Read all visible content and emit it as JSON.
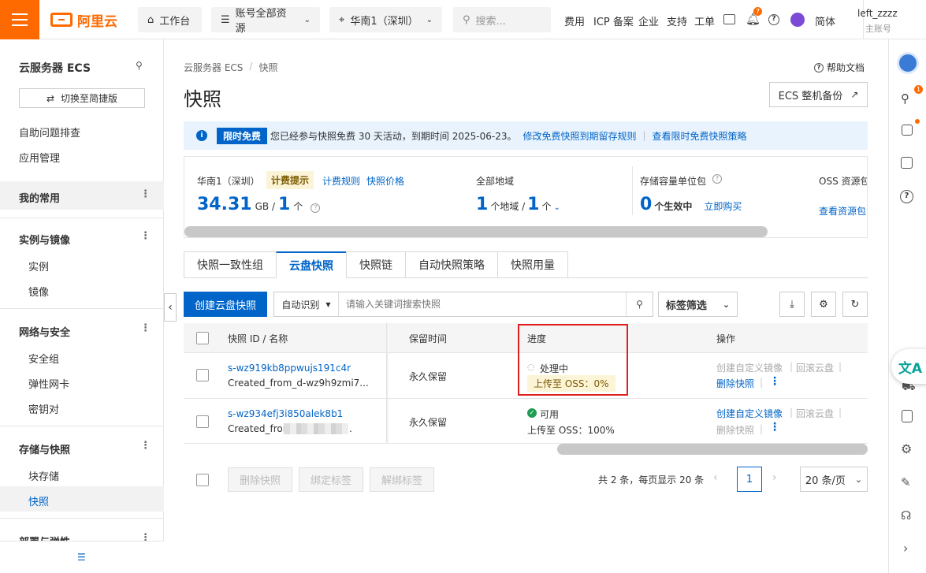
{
  "topbar": {
    "logo_text": "阿里云",
    "workbench": "工作台",
    "resources": "账号全部资源",
    "region": "华南1（深圳）",
    "search_placeholder": "搜索...",
    "links": [
      "费用",
      "ICP 备案",
      "企业",
      "支持",
      "工单"
    ],
    "bell_badge": "7",
    "language": "简体",
    "user_name": "left_zzzz",
    "user_role": "主账号"
  },
  "leftnav": {
    "title": "云服务器 ECS",
    "switch_button": "切换至简捷版",
    "items": [
      "自助问题排查",
      "应用管理"
    ],
    "favorites": "我的常用",
    "group_instances": "实例与镜像",
    "instances": "实例",
    "images": "镜像",
    "group_network": "网络与安全",
    "security_group": "安全组",
    "eni": "弹性网卡",
    "keypair": "密钥对",
    "group_storage": "存储与快照",
    "block_storage": "块存储",
    "snapshot": "快照",
    "group_deploy": "部署与弹性"
  },
  "main": {
    "breadcrumb": [
      "云服务器 ECS",
      "/",
      "快照"
    ],
    "help": "帮助文档",
    "page_title": "快照",
    "backup_button": "ECS 整机备份",
    "notice": {
      "tag": "限时免费",
      "text": "您已经参与快照免费 30 天活动，到期时间 2025-06-23。",
      "link1": "修改免费快照到期留存规则",
      "sep": "|",
      "link2": "查看限时免费快照策略"
    },
    "stats": {
      "region_label": "华南1（深圳）",
      "billing_tip": "计费提示",
      "billing_rule": "计费规则",
      "snapshot_price": "快照价格",
      "size_value": "34.31",
      "size_unit": "GB /",
      "count_value": "1",
      "count_unit": "个",
      "all_region_label": "全部地域",
      "regions_value": "1",
      "regions_unit": "个地域 /",
      "regions_count": "1",
      "regions_count_unit": "个",
      "pack_label": "存储容量单位包",
      "pack_value": "0",
      "pack_unit": "个生效中",
      "buy_now": "立即购买",
      "oss_label": "OSS 资源包",
      "oss_link": "查看资源包"
    },
    "tabs": [
      "快照一致性组",
      "云盘快照",
      "快照链",
      "自动快照策略",
      "快照用量"
    ],
    "create_button": "创建云盘快照",
    "auto_detect": "自动识别",
    "search_placeholder": "请输入关键词搜索快照",
    "tag_filter": "标签筛选",
    "table": {
      "headers": [
        "快照 ID / 名称",
        "保留时间",
        "进度",
        "操作"
      ],
      "rows": [
        {
          "id": "s-wz919kb8ppwujs191c4r",
          "name": "Created_from_d-wz9h9zmi7...",
          "retention": "永久保留",
          "status": "处理中",
          "oss": "上传至 OSS：0%",
          "op1": "创建自定义镜像",
          "op2": "回滚云盘",
          "op3": "删除快照"
        },
        {
          "id": "s-wz934efj3i850alek8b1",
          "name": "Created_from",
          "name_tail": ".",
          "retention": "永久保留",
          "status": "可用",
          "oss": "上传至 OSS：100%",
          "op1": "创建自定义镜像",
          "op2": "回滚云盘",
          "op3": "删除快照"
        }
      ]
    },
    "footer": {
      "delete": "删除快照",
      "bind_tag": "绑定标签",
      "unbind_tag": "解绑标签",
      "summary": "共 2 条，每页显示 20 条",
      "page": "1",
      "page_size": "20 条/页"
    }
  },
  "colors": {
    "brand": "#ff6a00",
    "primary": "#0064c8",
    "highlight_box": "#e02020",
    "success": "#1f9d55"
  }
}
